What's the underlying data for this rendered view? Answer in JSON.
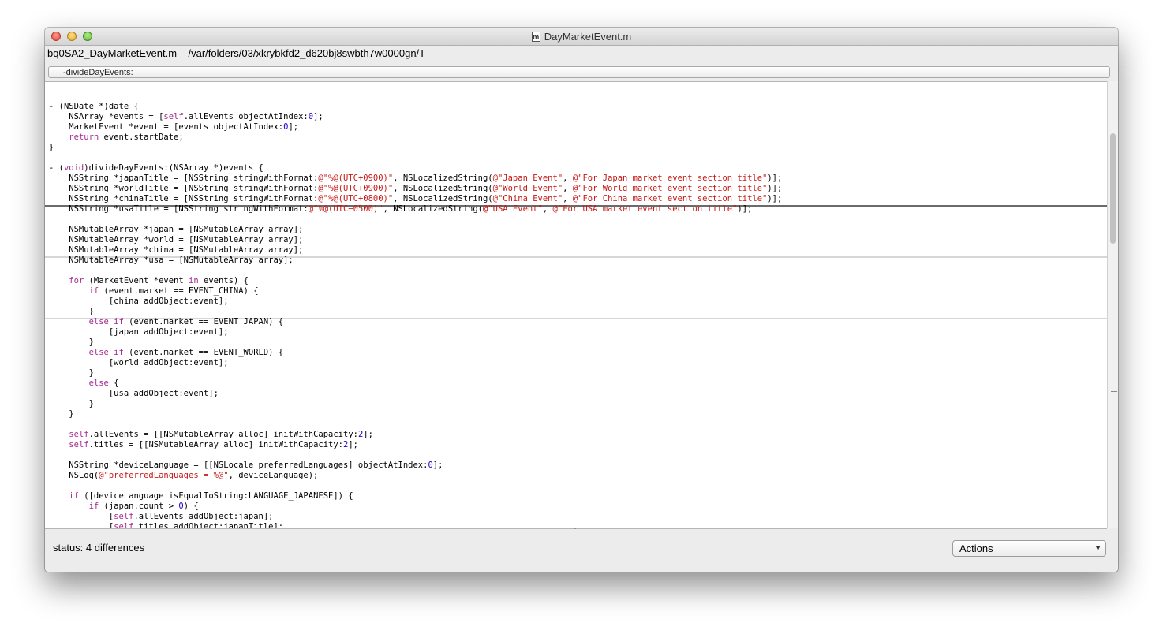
{
  "window": {
    "title": "DayMarketEvent.m",
    "file_icon_glyph": "m",
    "path": "bq0SA2_DayMarketEvent.m – /var/folders/03/xkrybkfd2_d620bj8swbth7w0000gn/T"
  },
  "function_popup": {
    "label": "-divideDayEvents:"
  },
  "code_lines": [
    [
      [
        "t",
        "- (NSDate *)date {"
      ]
    ],
    [
      [
        "t",
        "    NSArray *events = ["
      ],
      [
        "kw",
        "self"
      ],
      [
        "t",
        ".allEvents objectAtIndex:"
      ],
      [
        "num",
        "0"
      ],
      [
        "t",
        "];"
      ]
    ],
    [
      [
        "t",
        "    MarketEvent *event = [events objectAtIndex:"
      ],
      [
        "num",
        "0"
      ],
      [
        "t",
        "];"
      ]
    ],
    [
      [
        "t",
        "    "
      ],
      [
        "kw",
        "return"
      ],
      [
        "t",
        " event.startDate;"
      ]
    ],
    [
      [
        "t",
        "}"
      ]
    ],
    [
      [
        "t",
        ""
      ]
    ],
    [
      [
        "t",
        "- ("
      ],
      [
        "kw",
        "void"
      ],
      [
        "t",
        ")divideDayEvents:(NSArray *)events {"
      ]
    ],
    [
      [
        "t",
        "    NSString *japanTitle = [NSString stringWithFormat:"
      ],
      [
        "str",
        "@\"%@(UTC+0900)\""
      ],
      [
        "t",
        ", NSLocalizedString("
      ],
      [
        "str",
        "@\"Japan Event\""
      ],
      [
        "t",
        ", "
      ],
      [
        "str",
        "@\"For Japan market event section title\""
      ],
      [
        "t",
        ")];"
      ]
    ],
    [
      [
        "t",
        "    NSString *worldTitle = [NSString stringWithFormat:"
      ],
      [
        "str",
        "@\"%@(UTC+0900)\""
      ],
      [
        "t",
        ", NSLocalizedString("
      ],
      [
        "str",
        "@\"World Event\""
      ],
      [
        "t",
        ", "
      ],
      [
        "str",
        "@\"For World market event section title\""
      ],
      [
        "t",
        ")];"
      ]
    ],
    [
      [
        "t",
        "    NSString *chinaTitle = [NSString stringWithFormat:"
      ],
      [
        "str",
        "@\"%@(UTC+0800)\""
      ],
      [
        "t",
        ", NSLocalizedString("
      ],
      [
        "str",
        "@\"China Event\""
      ],
      [
        "t",
        ", "
      ],
      [
        "str",
        "@\"For China market event section title\""
      ],
      [
        "t",
        ")];"
      ]
    ],
    [
      [
        "t",
        "    NSString *usaTitle = [NSString stringWithFormat:"
      ],
      [
        "str",
        "@\"%@(UTC−0500)\""
      ],
      [
        "t",
        ", NSLocalizedString("
      ],
      [
        "str",
        "@\"USA Event\""
      ],
      [
        "t",
        ", "
      ],
      [
        "str",
        "@\"For USA market event section title\""
      ],
      [
        "t",
        ")];"
      ]
    ],
    [
      [
        "t",
        ""
      ]
    ],
    [
      [
        "t",
        "    NSMutableArray *japan = [NSMutableArray array];"
      ]
    ],
    [
      [
        "t",
        "    NSMutableArray *world = [NSMutableArray array];"
      ]
    ],
    [
      [
        "t",
        "    NSMutableArray *china = [NSMutableArray array];"
      ]
    ],
    [
      [
        "t",
        "    NSMutableArray *usa = [NSMutableArray array];"
      ]
    ],
    [
      [
        "t",
        ""
      ]
    ],
    [
      [
        "t",
        "    "
      ],
      [
        "kw",
        "for"
      ],
      [
        "t",
        " (MarketEvent *event "
      ],
      [
        "kw",
        "in"
      ],
      [
        "t",
        " events) {"
      ]
    ],
    [
      [
        "t",
        "        "
      ],
      [
        "kw",
        "if"
      ],
      [
        "t",
        " (event.market == EVENT_CHINA) {"
      ]
    ],
    [
      [
        "t",
        "            [china addObject:event];"
      ]
    ],
    [
      [
        "t",
        "        }"
      ]
    ],
    [
      [
        "t",
        "        "
      ],
      [
        "kw",
        "else if"
      ],
      [
        "t",
        " (event.market == EVENT_JAPAN) {"
      ]
    ],
    [
      [
        "t",
        "            [japan addObject:event];"
      ]
    ],
    [
      [
        "t",
        "        }"
      ]
    ],
    [
      [
        "t",
        "        "
      ],
      [
        "kw",
        "else if"
      ],
      [
        "t",
        " (event.market == EVENT_WORLD) {"
      ]
    ],
    [
      [
        "t",
        "            [world addObject:event];"
      ]
    ],
    [
      [
        "t",
        "        }"
      ]
    ],
    [
      [
        "t",
        "        "
      ],
      [
        "kw",
        "else"
      ],
      [
        "t",
        " {"
      ]
    ],
    [
      [
        "t",
        "            [usa addObject:event];"
      ]
    ],
    [
      [
        "t",
        "        }"
      ]
    ],
    [
      [
        "t",
        "    }"
      ]
    ],
    [
      [
        "t",
        ""
      ]
    ],
    [
      [
        "t",
        "    "
      ],
      [
        "kw",
        "self"
      ],
      [
        "t",
        ".allEvents = [[NSMutableArray alloc] initWithCapacity:"
      ],
      [
        "num",
        "2"
      ],
      [
        "t",
        "];"
      ]
    ],
    [
      [
        "t",
        "    "
      ],
      [
        "kw",
        "self"
      ],
      [
        "t",
        ".titles = [[NSMutableArray alloc] initWithCapacity:"
      ],
      [
        "num",
        "2"
      ],
      [
        "t",
        "];"
      ]
    ],
    [
      [
        "t",
        ""
      ]
    ],
    [
      [
        "t",
        "    NSString *deviceLanguage = [[NSLocale preferredLanguages] objectAtIndex:"
      ],
      [
        "num",
        "0"
      ],
      [
        "t",
        "];"
      ]
    ],
    [
      [
        "t",
        "    NSLog("
      ],
      [
        "str",
        "@\"preferredLanguages = %@\""
      ],
      [
        "t",
        ", deviceLanguage);"
      ]
    ],
    [
      [
        "t",
        ""
      ]
    ],
    [
      [
        "t",
        "    "
      ],
      [
        "kw",
        "if"
      ],
      [
        "t",
        " ([deviceLanguage isEqualToString:LANGUAGE_JAPANESE]) {"
      ]
    ],
    [
      [
        "t",
        "        "
      ],
      [
        "kw",
        "if"
      ],
      [
        "t",
        " (japan.count > "
      ],
      [
        "num",
        "0"
      ],
      [
        "t",
        ") {"
      ]
    ],
    [
      [
        "t",
        "            ["
      ],
      [
        "kw",
        "self"
      ],
      [
        "t",
        ".allEvents addObject:japan];"
      ]
    ],
    [
      [
        "t",
        "            ["
      ],
      [
        "kw",
        "self"
      ],
      [
        "t",
        ".titles addObject:japanTitle];"
      ]
    ]
  ],
  "diff_markers": [
    {
      "after_line": 10,
      "weight": "strong"
    },
    {
      "after_line": 15,
      "weight": "light"
    },
    {
      "after_line": 21,
      "weight": "light"
    }
  ],
  "status": {
    "label": "status:",
    "value": "4 differences"
  },
  "actions": {
    "label": "Actions"
  },
  "colors": {
    "keyword": "#a5278f",
    "string": "#c41a16",
    "number": "#1c00cf"
  }
}
